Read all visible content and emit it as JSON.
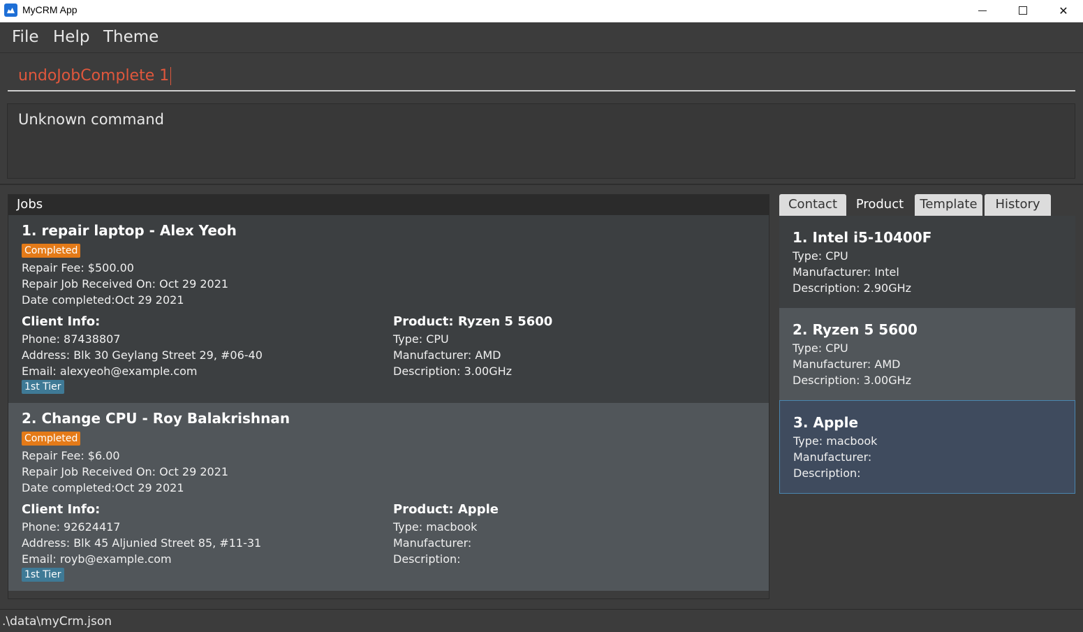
{
  "window": {
    "title": "MyCRM App"
  },
  "menu": {
    "file": "File",
    "help": "Help",
    "theme": "Theme"
  },
  "command": {
    "value": "undoJobComplete 1"
  },
  "result": {
    "text": "Unknown command"
  },
  "jobs": {
    "header": "Jobs",
    "items": [
      {
        "title": "1. repair laptop - Alex Yeoh",
        "status": "Completed",
        "fee": "Repair Fee: $500.00",
        "received": "Repair Job Received On: Oct 29 2021",
        "completed": "Date completed:Oct 29 2021",
        "client_head": "Client Info:",
        "phone": "Phone: 87438807",
        "address": "Address: Blk 30 Geylang Street 29, #06-40",
        "email": "Email: alexyeoh@example.com",
        "tier": "1st Tier",
        "product_head": "Product: Ryzen 5 5600",
        "ptype": "Type: CPU",
        "pmanu": "Manufacturer: AMD",
        "pdesc": "Description: 3.00GHz"
      },
      {
        "title": "2. Change CPU - Roy Balakrishnan",
        "status": "Completed",
        "fee": "Repair Fee: $6.00",
        "received": "Repair Job Received On: Oct 29 2021",
        "completed": "Date completed:Oct 29 2021",
        "client_head": "Client Info:",
        "phone": "Phone: 92624417",
        "address": "Address: Blk 45 Aljunied Street 85, #11-31",
        "email": "Email: royb@example.com",
        "tier": "1st Tier",
        "product_head": "Product: Apple",
        "ptype": "Type: macbook",
        "pmanu": "Manufacturer:",
        "pdesc": "Description:"
      }
    ]
  },
  "tabs": [
    "Contact",
    "Product",
    "Template",
    "History"
  ],
  "active_tab": "Product",
  "products": [
    {
      "title": "1.  Intel i5-10400F",
      "type": "Type: CPU",
      "manufacturer": "Manufacturer: Intel",
      "description": "Description: 2.90GHz"
    },
    {
      "title": "2.  Ryzen 5 5600",
      "type": "Type: CPU",
      "manufacturer": "Manufacturer: AMD",
      "description": "Description: 3.00GHz"
    },
    {
      "title": "3.  Apple",
      "type": "Type: macbook",
      "manufacturer": "Manufacturer:",
      "description": "Description:"
    }
  ],
  "status_bar": {
    "path": ".\\data\\myCrm.json"
  },
  "colors": {
    "accent_command": "#e0573c",
    "badge_completed": "#e47a18",
    "badge_tier": "#3f7a96",
    "selected_border": "#4a86b0"
  }
}
